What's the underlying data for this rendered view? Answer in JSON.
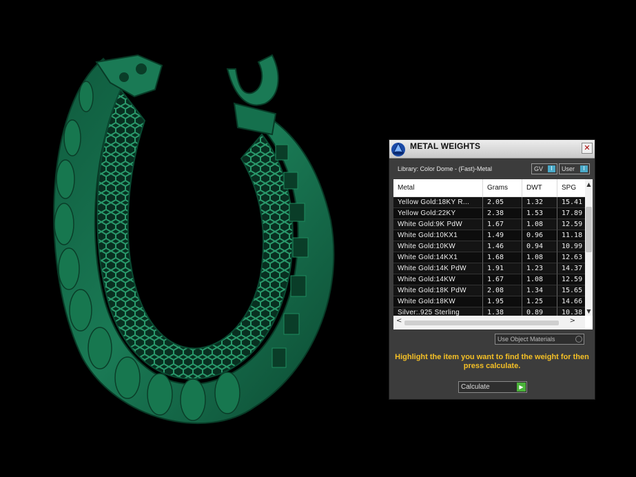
{
  "colors": {
    "model_green": "#1a7a55",
    "panel_bg": "#3c3c3c",
    "hint_text": "#f5c026",
    "toggle_accent": "#4aa9c8",
    "go_green": "#4bb33a"
  },
  "panel": {
    "title": "METAL WEIGHTS",
    "close_icon": "close-icon",
    "library_label": "Library: Color Dome - (Fast)-Metal",
    "gv_toggle": {
      "label": "GV",
      "indicator": "I"
    },
    "user_toggle": {
      "label": "User",
      "indicator": "I"
    },
    "table": {
      "columns": [
        "Metal",
        "Grams",
        "DWT",
        "SPG"
      ],
      "rows": [
        {
          "metal": "Yellow Gold:18KY R...",
          "grams": "2.05",
          "dwt": "1.32",
          "spg": "15.41"
        },
        {
          "metal": "Yellow Gold:22KY",
          "grams": "2.38",
          "dwt": "1.53",
          "spg": "17.89"
        },
        {
          "metal": "White Gold:9K PdW",
          "grams": "1.67",
          "dwt": "1.08",
          "spg": "12.59"
        },
        {
          "metal": "White Gold:10KX1",
          "grams": "1.49",
          "dwt": "0.96",
          "spg": "11.18"
        },
        {
          "metal": "White Gold:10KW",
          "grams": "1.46",
          "dwt": "0.94",
          "spg": "10.99"
        },
        {
          "metal": "White Gold:14KX1",
          "grams": "1.68",
          "dwt": "1.08",
          "spg": "12.63"
        },
        {
          "metal": "White Gold:14K PdW",
          "grams": "1.91",
          "dwt": "1.23",
          "spg": "14.37"
        },
        {
          "metal": "White Gold:14KW",
          "grams": "1.67",
          "dwt": "1.08",
          "spg": "12.59"
        },
        {
          "metal": "White Gold:18K PdW",
          "grams": "2.08",
          "dwt": "1.34",
          "spg": "15.65"
        },
        {
          "metal": "White Gold:18KW",
          "grams": "1.95",
          "dwt": "1.25",
          "spg": "14.66"
        },
        {
          "metal": "Silver:.925 Sterling",
          "grams": "1.38",
          "dwt": "0.89",
          "spg": "10.38"
        }
      ]
    },
    "use_object_materials": "Use Object Materials",
    "hint": "Highlight the item you want to find the weight for then press calculate.",
    "calculate_label": "Calculate"
  }
}
